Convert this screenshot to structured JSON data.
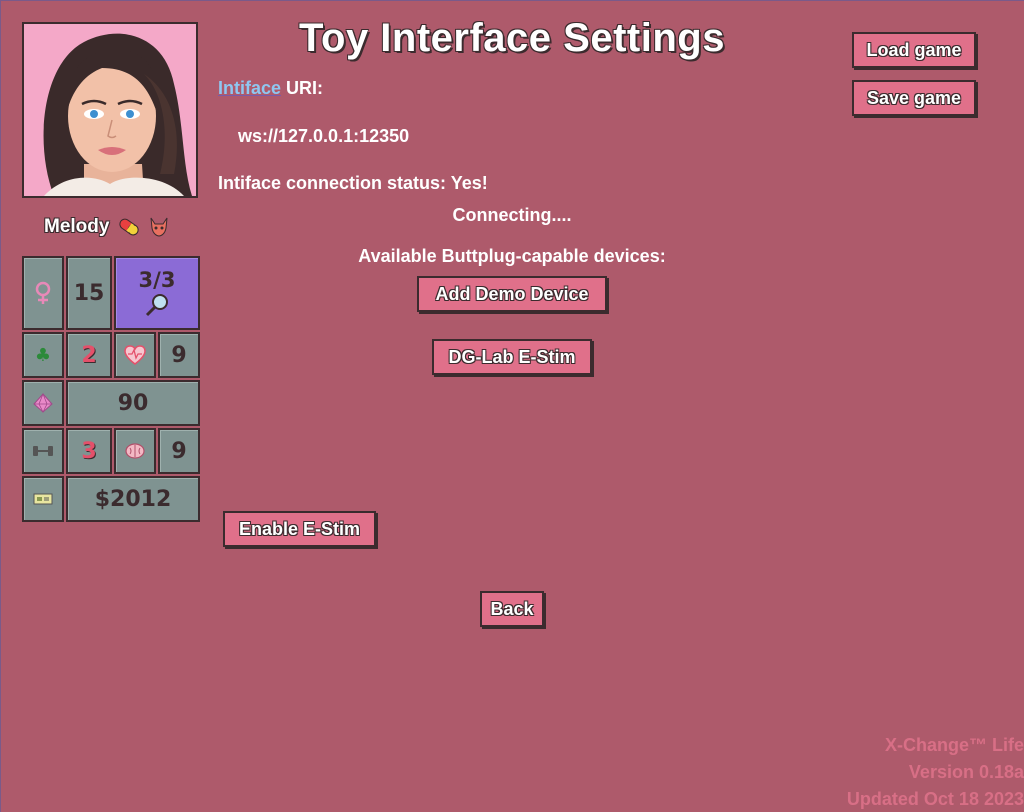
{
  "title": "Toy Interface Settings",
  "top_buttons": {
    "load": "Load game",
    "save": "Save game"
  },
  "character": {
    "name": "Melody",
    "stats": {
      "age": "15",
      "clues": "3/3",
      "luck": "2",
      "arousal": "9",
      "gems": "90",
      "strength": "3",
      "intellect": "9",
      "money": "$2012"
    }
  },
  "uri": {
    "link": "Intiface",
    "label": " URI:",
    "value": "ws://127.0.0.1:12350"
  },
  "status": {
    "text": "Intiface connection status: Yes!",
    "connecting": "Connecting...."
  },
  "devices": {
    "heading": "Available Buttplug-capable devices:",
    "add_demo": "Add Demo Device",
    "items": [
      "DG-Lab E-Stim"
    ]
  },
  "buttons": {
    "enable_estim": "Enable E-Stim",
    "back": "Back"
  },
  "footer": {
    "name": "X-Change™ Life",
    "version": "Version 0.18a",
    "updated": "Updated Oct 18 2023"
  },
  "colors": {
    "background": "#ae5a6b",
    "button": "#e0708a",
    "stat": "#7f9391",
    "stat_highlight": "#8b6bd6",
    "link": "#8fc7f0",
    "footer": "#d86f86"
  }
}
